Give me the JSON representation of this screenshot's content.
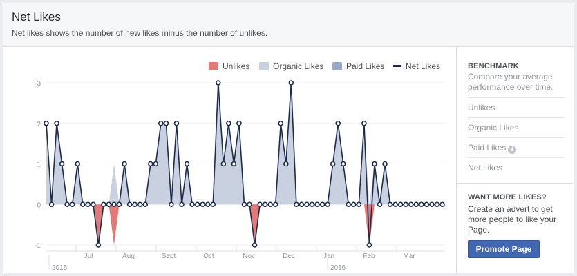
{
  "header": {
    "title": "Net Likes",
    "subtitle": "Net likes shows the number of new likes minus the number of unlikes."
  },
  "legend": {
    "unlikes": "Unlikes",
    "organic": "Organic Likes",
    "paid": "Paid Likes",
    "net": "Net Likes"
  },
  "sidebar": {
    "benchmark_heading": "BENCHMARK",
    "benchmark_desc": "Compare your average performance over time.",
    "items": [
      "Unlikes",
      "Organic Likes",
      "Paid Likes",
      "Net Likes"
    ],
    "more_heading": "WANT MORE LIKES?",
    "more_desc": "Create an advert to get more people to like your Page.",
    "promote_label": "Promote Page"
  },
  "colors": {
    "unlikes": "#e27a78",
    "organic": "#c9d0e0",
    "paid": "#9ba7c8",
    "net": "#1d2b4d",
    "button": "#4267b2"
  },
  "icons": {
    "paid_info": "info-icon"
  },
  "chart_data": {
    "type": "area",
    "ylim": [
      -1,
      3
    ],
    "y_ticks": [
      "-1",
      "0",
      "1",
      "2",
      "3"
    ],
    "month_labels": [
      "Jul",
      "Aug",
      "Sept",
      "Oct",
      "Nov",
      "Dec",
      "Jan",
      "Feb",
      "Mar"
    ],
    "year_labels": [
      "2015",
      "2016"
    ],
    "series": [
      {
        "name": "Net Likes",
        "values": [
          2,
          0,
          2,
          1,
          0,
          0,
          1,
          0,
          0,
          0,
          -1,
          0,
          0,
          0,
          0,
          1,
          0,
          0,
          0,
          0,
          1,
          1,
          2,
          2,
          0,
          2,
          0,
          1,
          0,
          0,
          0,
          0,
          0,
          3,
          1,
          2,
          1,
          2,
          0,
          0,
          -1,
          0,
          0,
          0,
          0,
          2,
          1,
          3,
          0,
          0,
          0,
          0,
          0,
          0,
          0,
          1,
          2,
          1,
          0,
          0,
          0,
          2,
          -1,
          1,
          0,
          1,
          0,
          0,
          0,
          0,
          0,
          0,
          0,
          0,
          0,
          0,
          0
        ]
      },
      {
        "name": "Unlikes",
        "values": [
          0,
          0,
          0,
          0,
          0,
          0,
          0,
          0,
          0,
          0,
          -1,
          0,
          0,
          -1,
          0,
          0,
          0,
          0,
          0,
          0,
          0,
          0,
          0,
          0,
          0,
          0,
          0,
          0,
          0,
          0,
          0,
          0,
          0,
          0,
          0,
          0,
          0,
          0,
          0,
          0,
          -1,
          0,
          0,
          0,
          0,
          0,
          0,
          0,
          0,
          0,
          0,
          0,
          0,
          0,
          0,
          0,
          0,
          0,
          0,
          0,
          0,
          0,
          -1,
          0,
          0,
          0,
          0,
          0,
          0,
          0,
          0,
          0,
          0,
          0,
          0,
          0,
          0
        ]
      },
      {
        "name": "Organic Likes",
        "values": [
          2,
          0,
          2,
          1,
          0,
          0,
          1,
          0,
          0,
          0,
          0,
          0,
          0,
          1,
          0,
          1,
          0,
          0,
          0,
          0,
          1,
          1,
          2,
          2,
          0,
          2,
          0,
          1,
          0,
          0,
          0,
          0,
          0,
          3,
          1,
          2,
          1,
          2,
          0,
          0,
          0,
          0,
          0,
          0,
          0,
          2,
          1,
          3,
          0,
          0,
          0,
          0,
          0,
          0,
          0,
          1,
          2,
          1,
          0,
          0,
          0,
          2,
          0,
          1,
          0,
          1,
          0,
          0,
          0,
          0,
          0,
          0,
          0,
          0,
          0,
          0,
          0
        ]
      }
    ]
  }
}
